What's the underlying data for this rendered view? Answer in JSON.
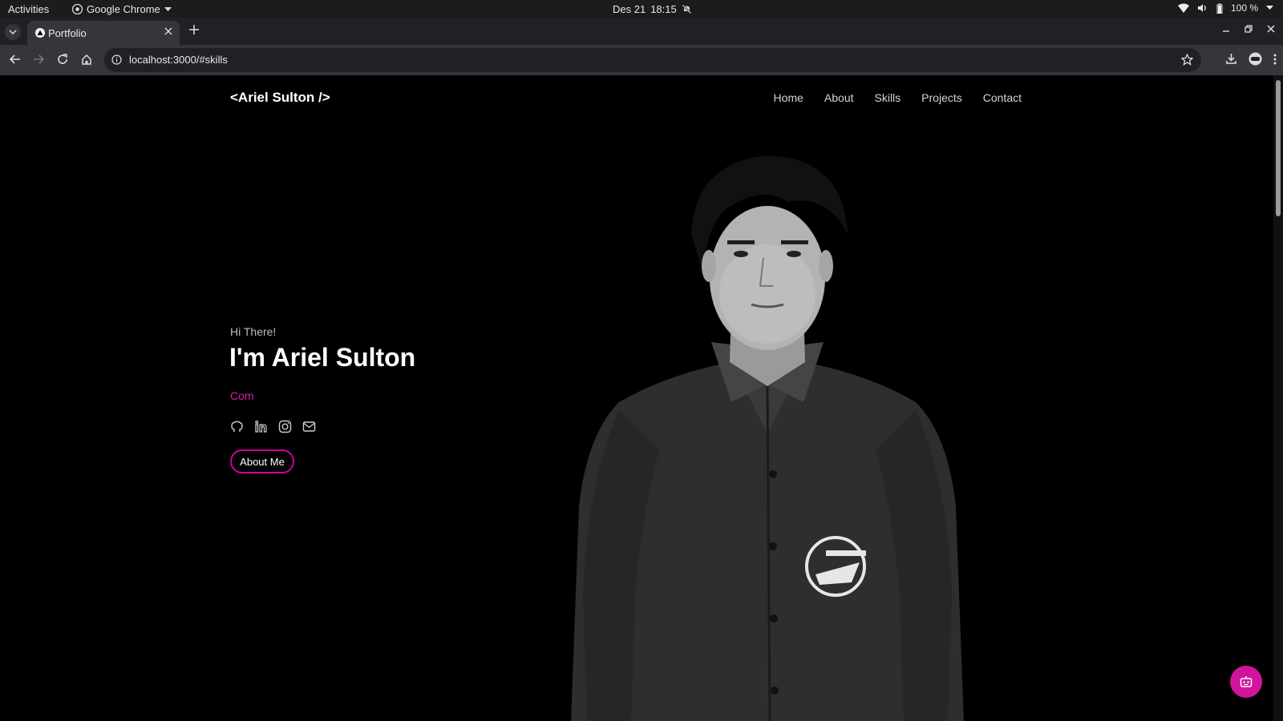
{
  "os": {
    "activities": "Activities",
    "app_name": "Google Chrome",
    "date": "Des 21",
    "time": "18:15",
    "battery": "100 %"
  },
  "browser": {
    "tab_title": "Portfolio",
    "url": "localhost:3000/#skills"
  },
  "site": {
    "logo": "<Ariel Sulton />",
    "nav": [
      "Home",
      "About",
      "Skills",
      "Projects",
      "Contact"
    ]
  },
  "hero": {
    "greeting": "Hi There!",
    "name": "I'm Ariel Sulton",
    "role_typing": "Com",
    "socials": [
      "github-icon",
      "linkedin-icon",
      "instagram-icon",
      "mail-icon"
    ],
    "cta_label": "About Me"
  },
  "colors": {
    "accent": "#d6209a",
    "chatbot": "#d0159c",
    "background": "#000000"
  }
}
